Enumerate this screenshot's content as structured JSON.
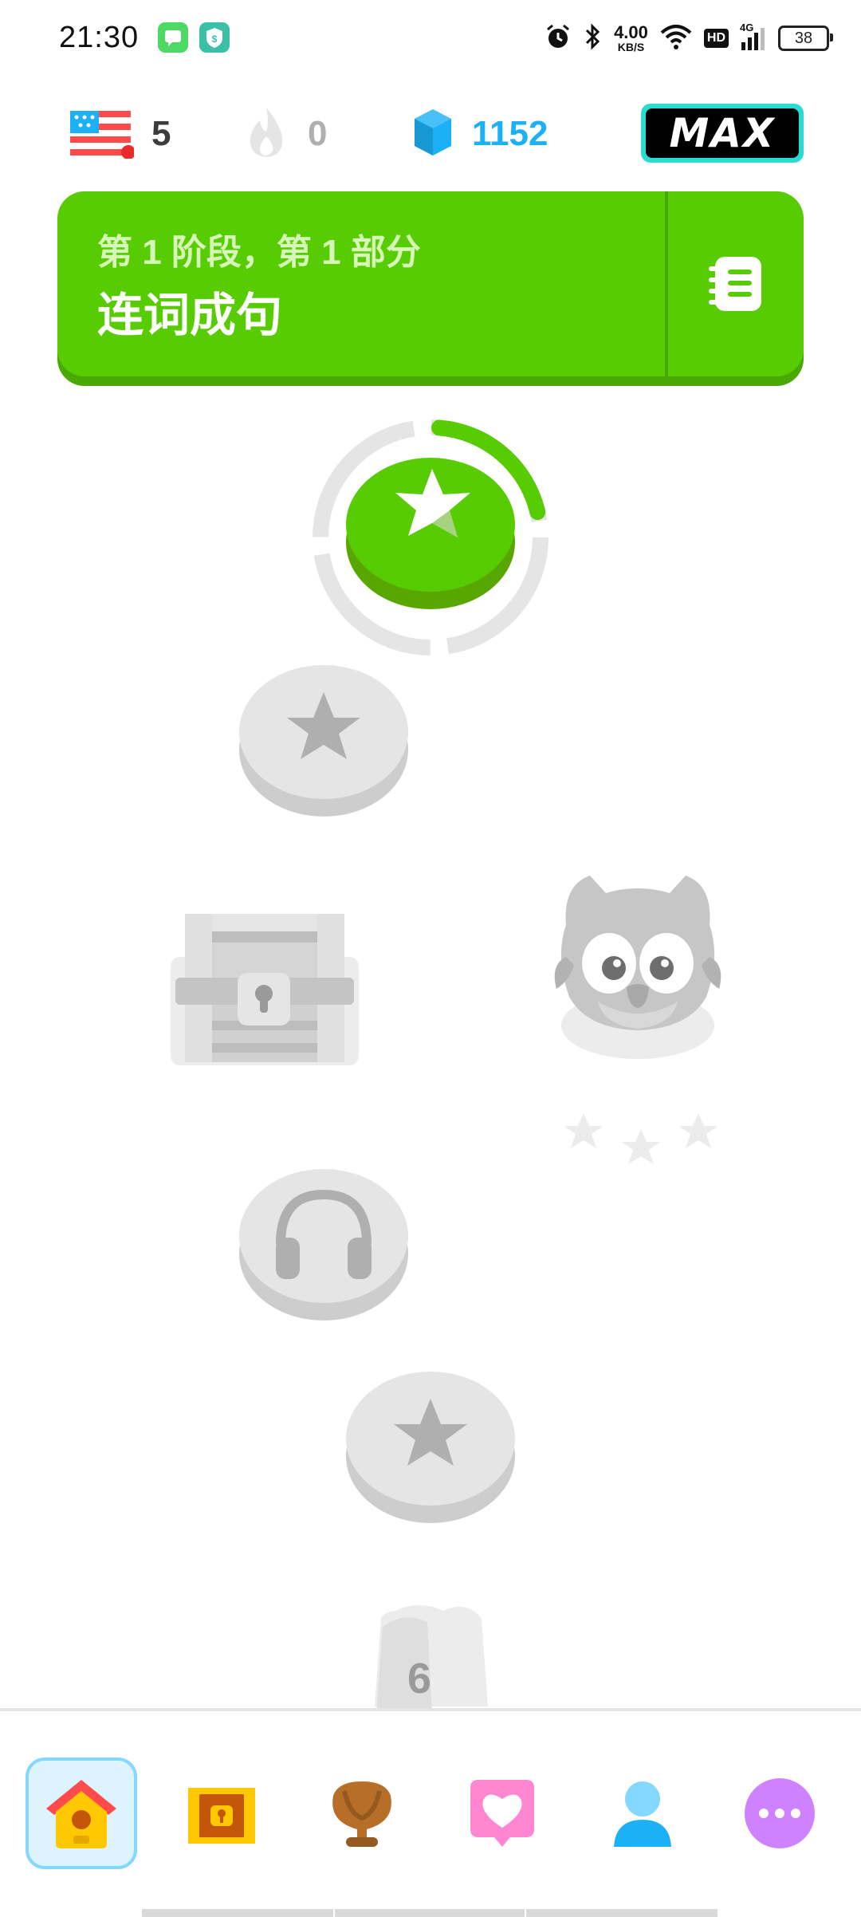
{
  "status_bar": {
    "time": "21:30",
    "network_speed_value": "4.00",
    "network_speed_unit": "KB/S",
    "hd_label": "HD",
    "signal_label": "4G",
    "battery_level": "38"
  },
  "top_bar": {
    "course_flag": "us-flag-icon",
    "course_count": "5",
    "streak_count": "0",
    "gems_count": "1152",
    "subscription_badge": "MAX"
  },
  "section_banner": {
    "subtitle": "第 1 阶段，第 1 部分",
    "title": "连词成句"
  },
  "path": {
    "active_progress": 0.2,
    "locked_unit_number": "6"
  },
  "bottom_nav": {
    "items": [
      {
        "name": "home",
        "icon": "home-icon",
        "active": true
      },
      {
        "name": "quests",
        "icon": "treasure-chest-icon",
        "active": false
      },
      {
        "name": "leagues",
        "icon": "trophy-icon",
        "active": false
      },
      {
        "name": "health",
        "icon": "heart-message-icon",
        "active": false
      },
      {
        "name": "profile",
        "icon": "profile-icon",
        "active": false
      },
      {
        "name": "more",
        "icon": "more-icon",
        "active": false
      }
    ]
  },
  "colors": {
    "primary_green": "#58cc02",
    "gem_blue": "#1cb0f6",
    "locked_gray": "#e5e5e5",
    "max_border": "#2adbd0"
  }
}
